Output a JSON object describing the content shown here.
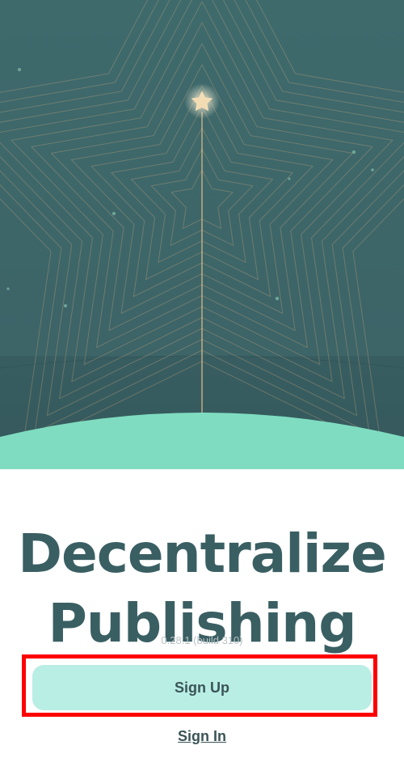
{
  "hero": {
    "illustration_icon": "star-illustration",
    "colors": {
      "sky": "#3f6c6e",
      "sky_dark": "#37595c",
      "ground": "#7fdcc0",
      "star": "#f3dcb4"
    }
  },
  "headline": {
    "line1": "Decentralize",
    "line2": "Publishing"
  },
  "version": "0.28.1 (build 310)",
  "actions": {
    "sign_up_label": "Sign Up",
    "sign_in_label": "Sign In"
  },
  "highlight_color": "#ff0000"
}
